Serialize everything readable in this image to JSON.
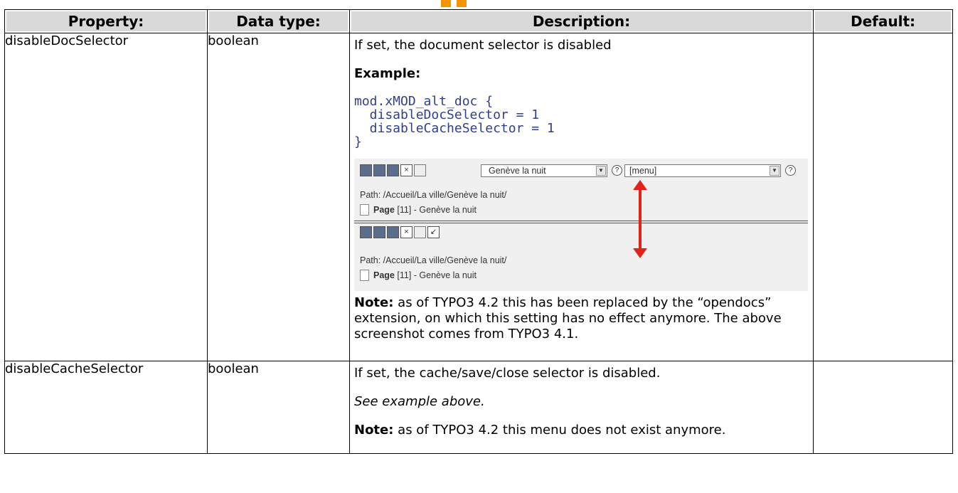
{
  "columns": [
    "Property:",
    "Data type:",
    "Description:",
    "Default:"
  ],
  "rows": [
    {
      "property": "disableDocSelector",
      "datatype": "boolean",
      "intro": "If set, the document selector is disabled",
      "example_label": "Example:",
      "code": "mod.xMOD_alt_doc {\n  disableDocSelector = 1\n  disableCacheSelector = 1\n}",
      "screenshot": {
        "doc_select": "Genève la nuit",
        "menu_select": "[menu]",
        "help_glyph": "?",
        "path": "Path: /Accueil/La ville/Genève la nuit/",
        "page_label": "Page",
        "page_rest": " [11] - Genève la nuit",
        "arrow_color": "#e2231a"
      },
      "note_label": "Note:",
      "note_text": " as of TYPO3 4.2 this has been replaced by the “opendocs” extension, on which this setting has no effect anymore. The above screenshot comes from TYPO3 4.1.",
      "default": ""
    },
    {
      "property": "disableCacheSelector",
      "datatype": "boolean",
      "intro": "If set, the cache/save/close selector is disabled.",
      "see_example": "See example above.",
      "note_label": "Note:",
      "note_text": " as of TYPO3 4.2 this menu does not exist anymore.",
      "default": ""
    }
  ],
  "colors": {
    "header_bg": "#d9d9d9",
    "code_color": "#2f3f8f",
    "top_marks": "#f29400"
  }
}
